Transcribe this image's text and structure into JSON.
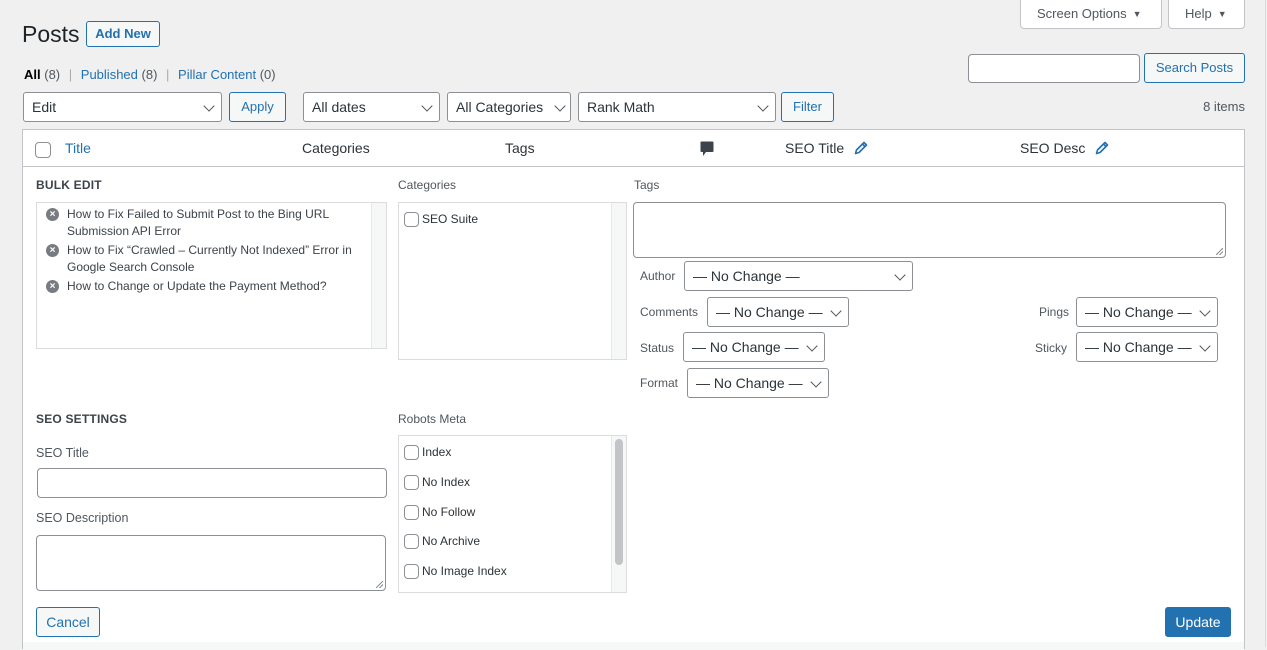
{
  "screen_meta": {
    "screen_options_label": "Screen Options",
    "help_label": "Help",
    "arrow_glyph": "▼"
  },
  "header": {
    "title": "Posts",
    "add_new_label": "Add New"
  },
  "views": [
    {
      "label": "All",
      "count": "(8)",
      "current": true
    },
    {
      "label": "Published",
      "count": "(8)",
      "current": false
    },
    {
      "label": "Pillar Content",
      "count": "(0)",
      "current": false
    }
  ],
  "views_separator": "|",
  "search": {
    "value": "",
    "placeholder": "",
    "button_label": "Search Posts"
  },
  "tablenav": {
    "bulk_action": "Edit",
    "apply_label": "Apply",
    "date_filter": "All dates",
    "category_filter": "All Categories",
    "seo_filter": "Rank Math",
    "filter_label": "Filter",
    "items_count": "8 items"
  },
  "columns": {
    "title": "Title",
    "categories": "Categories",
    "tags": "Tags",
    "comments_icon": "comment-bubble-icon",
    "seo_title": "SEO Title",
    "seo_desc": "SEO Desc",
    "edit_icon": "pencil-icon"
  },
  "bulk_edit": {
    "heading": "BULK EDIT",
    "remove_icon": "×",
    "posts": [
      "How to Fix Failed to Submit Post to the Bing URL Submission API Error",
      "How to Fix “Crawled – Currently Not Indexed” Error in Google Search Console",
      "How to Change or Update the Payment Method?"
    ],
    "categories_label": "Categories",
    "categories": [
      {
        "label": "SEO Suite",
        "checked": false
      }
    ],
    "tags_label": "Tags",
    "tags_value": "",
    "fields": {
      "author": {
        "label": "Author",
        "value": "— No Change —"
      },
      "comments": {
        "label": "Comments",
        "value": "— No Change —"
      },
      "status": {
        "label": "Status",
        "value": "— No Change —"
      },
      "format": {
        "label": "Format",
        "value": "— No Change —"
      },
      "pings": {
        "label": "Pings",
        "value": "— No Change —"
      },
      "sticky": {
        "label": "Sticky",
        "value": "— No Change —"
      }
    }
  },
  "seo_settings": {
    "heading": "SEO SETTINGS",
    "seo_title_label": "SEO Title",
    "seo_title_value": "",
    "seo_description_label": "SEO Description",
    "seo_description_value": "",
    "robots_label": "Robots Meta",
    "robots": [
      {
        "label": "Index",
        "checked": false
      },
      {
        "label": "No Index",
        "checked": false
      },
      {
        "label": "No Follow",
        "checked": false
      },
      {
        "label": "No Archive",
        "checked": false
      },
      {
        "label": "No Image Index",
        "checked": false
      }
    ]
  },
  "actions": {
    "cancel_label": "Cancel",
    "update_label": "Update"
  },
  "colors": {
    "accent": "#2271b1",
    "background": "#f0f0f1",
    "text": "#1d2327",
    "border": "#c3c4c7"
  }
}
